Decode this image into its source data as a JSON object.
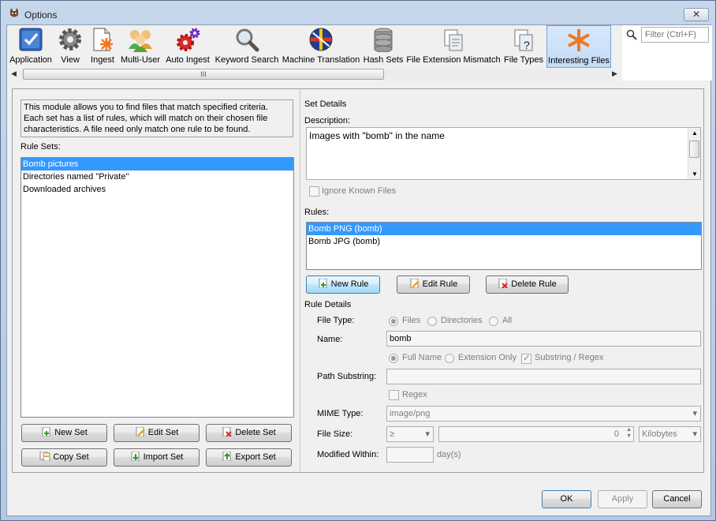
{
  "window": {
    "title": "Options",
    "close_glyph": "✕"
  },
  "toolbar": {
    "items": [
      {
        "label": "Application",
        "icon": "application-check-icon"
      },
      {
        "label": "View",
        "icon": "gear-icon"
      },
      {
        "label": "Ingest",
        "icon": "ingest-document-icon"
      },
      {
        "label": "Multi-User",
        "icon": "users-group-icon"
      },
      {
        "label": "Auto Ingest",
        "icon": "red-gears-icon"
      },
      {
        "label": "Keyword Search",
        "icon": "magnifier-icon"
      },
      {
        "label": "Machine Translation",
        "icon": "globe-flags-icon"
      },
      {
        "label": "Hash Sets",
        "icon": "database-icon"
      },
      {
        "label": "File Extension Mismatch",
        "icon": "file-mismatch-icon"
      },
      {
        "label": "File Types",
        "icon": "file-types-icon"
      },
      {
        "label": "Interesting Files",
        "icon": "asterisk-icon"
      }
    ],
    "selected": "Interesting Files",
    "scroll_grip": "III"
  },
  "filter": {
    "placeholder": "Filter (Ctrl+F)"
  },
  "left": {
    "module_description": "This module allows you to find files that match specified criteria. Each set has a list of rules, which will match on their chosen file characteristics. A file need only match one rule to be found.",
    "rule_sets_label": "Rule Sets:",
    "rule_sets": [
      "Bomb pictures",
      "Directories named \"Private\"",
      "Downloaded archives"
    ],
    "selected_rule_set": "Bomb pictures",
    "buttons": {
      "new_set": "New Set",
      "edit_set": "Edit Set",
      "delete_set": "Delete Set",
      "copy_set": "Copy Set",
      "import_set": "Import Set",
      "export_set": "Export Set"
    }
  },
  "set_details": {
    "heading": "Set Details",
    "description_label": "Description:",
    "description": "Images with \"bomb\" in the name",
    "ignore_known_label": "Ignore Known Files",
    "rules_label": "Rules:",
    "rules": [
      "Bomb PNG (bomb)",
      "Bomb JPG (bomb)"
    ],
    "selected_rule": "Bomb PNG (bomb)",
    "buttons": {
      "new_rule": "New Rule",
      "edit_rule": "Edit Rule",
      "delete_rule": "Delete Rule"
    }
  },
  "rule_details": {
    "heading": "Rule Details",
    "file_type_label": "File Type:",
    "file_type_options": [
      "Files",
      "Directories",
      "All"
    ],
    "file_type_selected": "Files",
    "name_label": "Name:",
    "name_value": "bomb",
    "name_options": [
      "Full Name",
      "Extension Only"
    ],
    "name_selected": "Full Name",
    "substring_regex_label": "Substring / Regex",
    "substring_regex_checked": true,
    "path_substring_label": "Path Substring:",
    "path_value": "",
    "regex_label": "Regex",
    "mime_label": "MIME Type:",
    "mime_value": "image/png",
    "file_size_label": "File Size:",
    "file_size_op": "≥",
    "file_size_value": "0",
    "file_size_unit": "Kilobytes",
    "modified_label": "Modified Within:",
    "modified_unit": "day(s)"
  },
  "footer": {
    "ok": "OK",
    "apply": "Apply",
    "cancel": "Cancel"
  }
}
